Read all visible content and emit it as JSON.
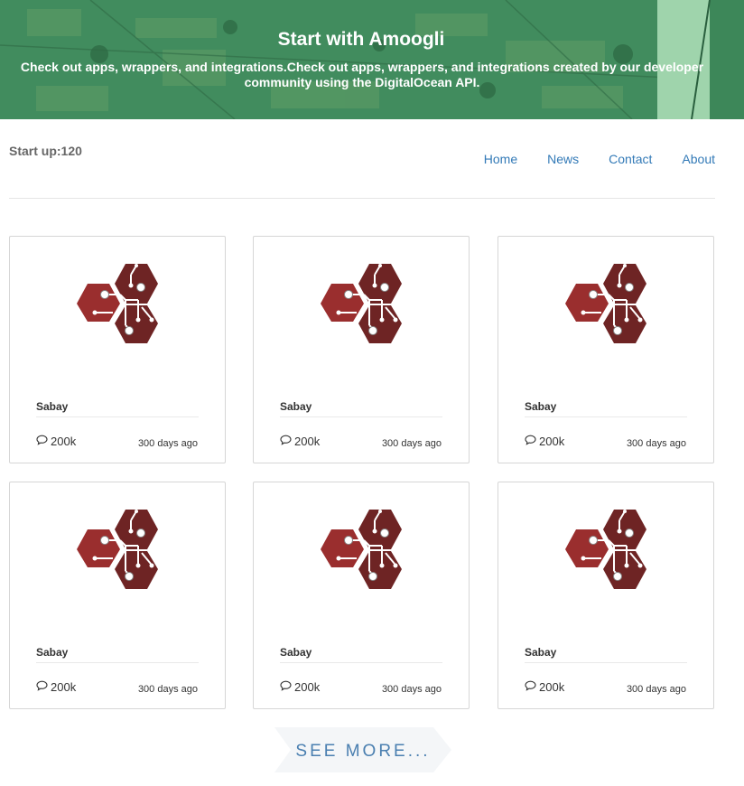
{
  "hero": {
    "title": "Start with Amoogli",
    "subtitle": "Check out apps, wrappers, and integrations.Check out apps, wrappers, and integrations created by our developer community using the DigitalOcean API."
  },
  "topbar": {
    "startup_label": "Start up:120"
  },
  "nav": {
    "items": [
      "Home",
      "News",
      "Contact",
      "About"
    ]
  },
  "cards": [
    {
      "name": "Sabay",
      "comments": "200k",
      "age": "300 days ago"
    },
    {
      "name": "Sabay",
      "comments": "200k",
      "age": "300 days ago"
    },
    {
      "name": "Sabay",
      "comments": "200k",
      "age": "300 days ago"
    },
    {
      "name": "Sabay",
      "comments": "200k",
      "age": "300 days ago"
    },
    {
      "name": "Sabay",
      "comments": "200k",
      "age": "300 days ago"
    },
    {
      "name": "Sabay",
      "comments": "200k",
      "age": "300 days ago"
    }
  ],
  "see_more": "SEE MORE...",
  "icons": {
    "card_logo": "hexagon-circuit-logo-icon",
    "comment": "speech-bubble-icon"
  },
  "colors": {
    "hero_green": "#3f8a5c",
    "link_blue": "#337ab7",
    "logo_dark_red": "#6e2424",
    "logo_red": "#9a2e2e"
  }
}
